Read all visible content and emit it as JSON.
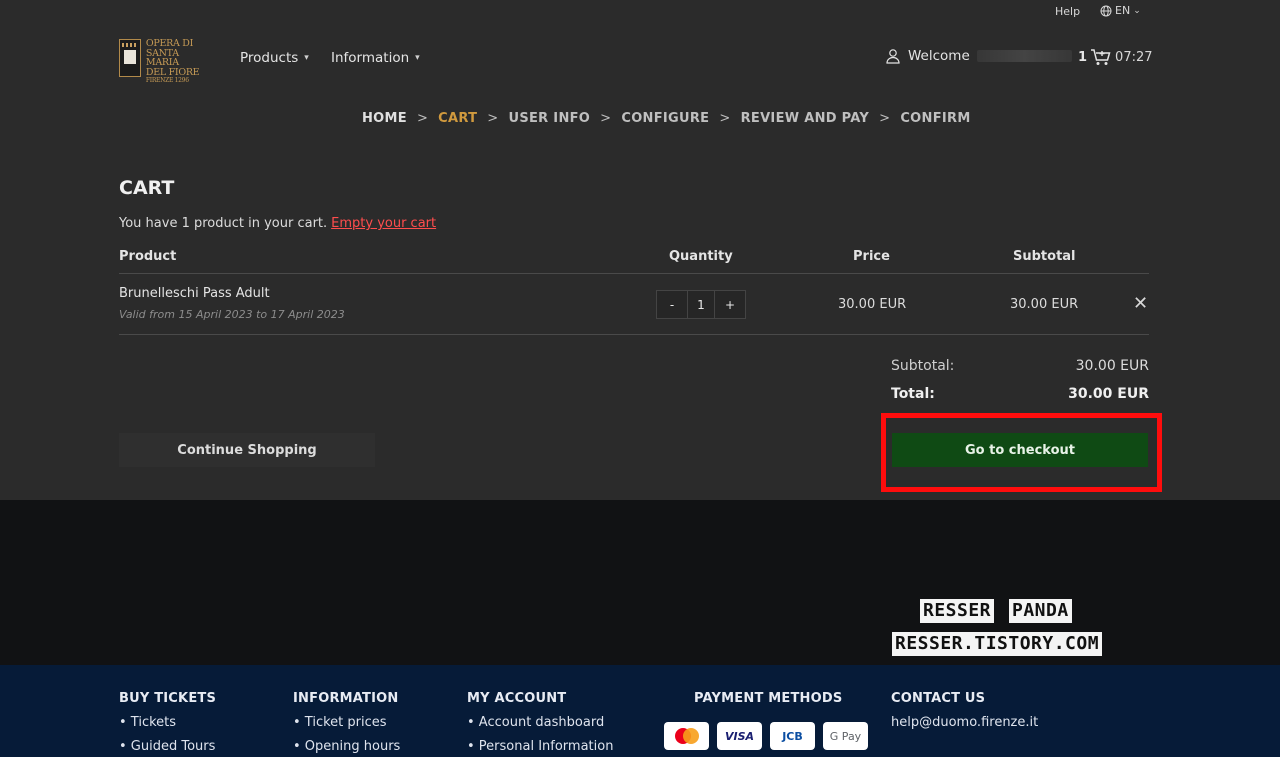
{
  "topbar": {
    "help": "Help",
    "lang": "EN"
  },
  "logo": {
    "line1": "OPERA DI",
    "line2": "SANTA MARIA",
    "line3": "DEL FIORE",
    "line4": "FIRENZE 1296"
  },
  "nav": {
    "products": "Products",
    "information": "Information"
  },
  "user": {
    "welcome": "Welcome"
  },
  "cart_badge": {
    "count": "1",
    "timer": "07:27"
  },
  "breadcrumb": [
    "HOME",
    "CART",
    "USER INFO",
    "CONFIGURE",
    "REVIEW AND PAY",
    "CONFIRM"
  ],
  "breadcrumb_sep": ">",
  "cart": {
    "title": "CART",
    "summary": "You have 1 product in your cart.",
    "empty_link": "Empty your cart",
    "headers": {
      "product": "Product",
      "quantity": "Quantity",
      "price": "Price",
      "subtotal": "Subtotal"
    },
    "item": {
      "name": "Brunelleschi Pass Adult",
      "validity": "Valid from 15 April 2023 to 17 April 2023",
      "minus": "-",
      "qty": "1",
      "plus": "+",
      "price": "30.00 EUR",
      "subtotal": "30.00 EUR",
      "remove": "✕"
    },
    "totals": {
      "subtotal_label": "Subtotal:",
      "subtotal_value": "30.00 EUR",
      "total_label": "Total:",
      "total_value": "30.00 EUR"
    },
    "continue_label": "Continue Shopping",
    "checkout_label": "Go to checkout"
  },
  "watermark": {
    "line1a": "RESSER",
    "line1b": "PANDA",
    "line2": "RESSER.TISTORY.COM"
  },
  "footer": {
    "buy": {
      "title": "BUY TICKETS",
      "items": [
        "• Tickets",
        "• Guided Tours"
      ]
    },
    "info": {
      "title": "INFORMATION",
      "items": [
        "• Ticket prices",
        "• Opening hours"
      ]
    },
    "account": {
      "title": "MY ACCOUNT",
      "items": [
        "• Account dashboard",
        "• Personal Information"
      ]
    },
    "payment": {
      "title": "PAYMENT METHODS",
      "cards": [
        "VISA",
        "JCB",
        "G Pay"
      ]
    },
    "contact": {
      "title": "CONTACT US",
      "email": "help@duomo.firenze.it"
    }
  },
  "colors": {
    "accent": "#d19a3e",
    "checkout_bg": "#0f4a14",
    "highlight": "#ff0d0d",
    "link_red": "#ff4d4d",
    "footer_bg": "#061b38"
  }
}
